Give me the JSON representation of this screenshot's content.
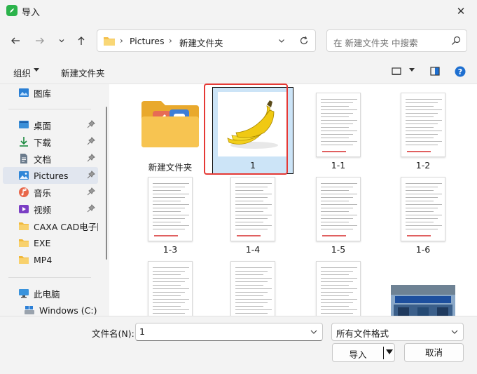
{
  "window": {
    "title": "导入",
    "close_glyph": "✕"
  },
  "nav": {
    "back_icon": "arrow-left-icon",
    "forward_icon": "arrow-right-icon",
    "recent_icon": "chevron-down-icon",
    "up_icon": "arrow-up-icon"
  },
  "address": {
    "crumbs": [
      "Pictures",
      "新建文件夹"
    ],
    "separator": "›"
  },
  "search": {
    "placeholder": "在 新建文件夹 中搜索"
  },
  "toolbar": {
    "organize": "组织",
    "new_folder": "新建文件夹"
  },
  "sidebar": {
    "items": [
      {
        "label": "图库",
        "icon": "gallery-icon",
        "pinned": false
      },
      {
        "label": "桌面",
        "icon": "desktop-icon",
        "pinned": true
      },
      {
        "label": "下载",
        "icon": "download-icon",
        "pinned": true
      },
      {
        "label": "文档",
        "icon": "document-icon",
        "pinned": true
      },
      {
        "label": "Pictures",
        "icon": "pictures-icon",
        "pinned": true,
        "selected": true
      },
      {
        "label": "音乐",
        "icon": "music-icon",
        "pinned": true
      },
      {
        "label": "视频",
        "icon": "video-icon",
        "pinned": true
      },
      {
        "label": "CAXA CAD电子图",
        "icon": "folder-icon",
        "pinned": false
      },
      {
        "label": "EXE",
        "icon": "folder-icon",
        "pinned": false
      },
      {
        "label": "MP4",
        "icon": "folder-icon",
        "pinned": false
      },
      {
        "label": "此电脑",
        "icon": "computer-icon",
        "pinned": false
      },
      {
        "label": "Windows (C:)",
        "icon": "drive-icon",
        "pinned": false
      }
    ]
  },
  "files": [
    {
      "name": "新建文件夹",
      "kind": "folder"
    },
    {
      "name": "1",
      "kind": "banana-image",
      "selected": true
    },
    {
      "name": "1-1",
      "kind": "document"
    },
    {
      "name": "1-2",
      "kind": "document"
    },
    {
      "name": "1-3",
      "kind": "document"
    },
    {
      "name": "1-4",
      "kind": "document"
    },
    {
      "name": "1-5",
      "kind": "document"
    },
    {
      "name": "1-6",
      "kind": "document"
    },
    {
      "name": "",
      "kind": "document"
    },
    {
      "name": "",
      "kind": "document"
    },
    {
      "name": "",
      "kind": "document"
    },
    {
      "name": "",
      "kind": "storefront-photo"
    }
  ],
  "footer": {
    "filename_label": "文件名(N):",
    "filename_value": "1",
    "filetype_value": "所有文件格式",
    "import_label": "导入",
    "cancel_label": "取消"
  },
  "colors": {
    "accent": "#0067c0",
    "highlight_box": "#e53935",
    "selection": "#cce4f7",
    "app_icon": "#2bb34b"
  }
}
